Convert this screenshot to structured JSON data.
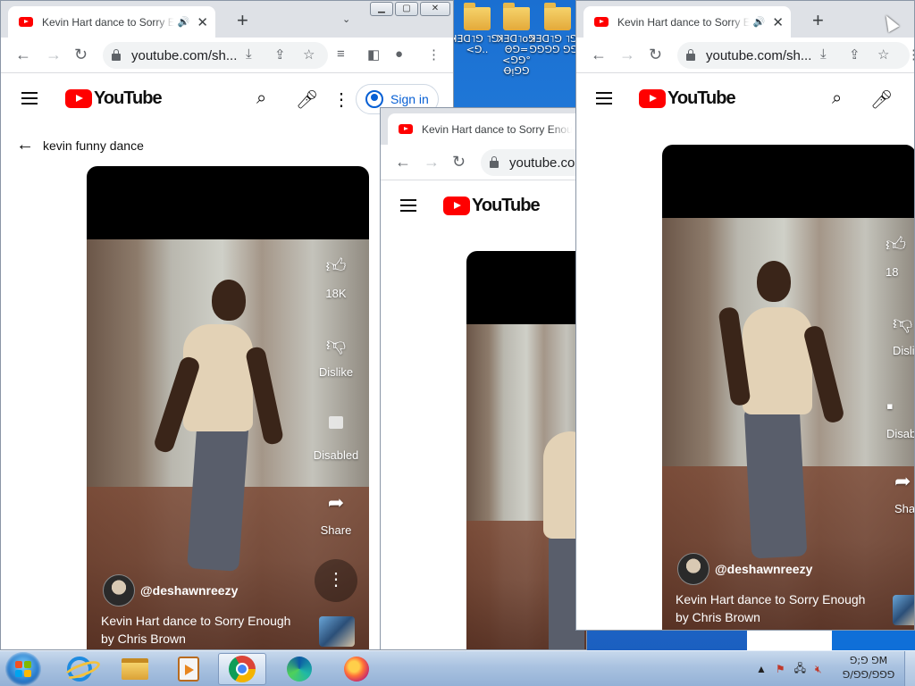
{
  "desktop": {
    "icons": [
      {
        "label": "ꓘƎᗡ˥ꓨ ˥ꓨ°\n<ꓨ..",
        "icon": "folder-icon"
      },
      {
        "label": "ꓘƎᗡ˥oꓨ Θꓨ=\n<ꓨꓨ° Ꝋᴉꓨꓨ",
        "icon": "folder-icon"
      },
      {
        "label": "ꓘƎᗡ˥ꓨ ˥ꓨ=\nꓨꓨꓨꓨ ꓨꓨꓨ",
        "icon": "folder-icon"
      }
    ]
  },
  "windows": [
    {
      "id": "left",
      "tab_title": "Kevin Hart dance to Sorry Enough",
      "url": "youtube.com/sh...",
      "youtube_label": "YouTube",
      "sign_in": "Sign in",
      "back_label": "kevin funny dance",
      "likes": "18K",
      "dislike": "Dislike",
      "comments": "Disabled",
      "share": "Share",
      "channel": "@deshawnreezy",
      "video_title_line1": "Kevin Hart dance to Sorry Enough",
      "video_title_line2": "by Chris Brown"
    },
    {
      "id": "middle",
      "tab_title": "Kevin Hart dance to Sorry Enough",
      "url": "youtube.com",
      "youtube_label": "YouTube"
    },
    {
      "id": "right",
      "tab_title": "Kevin Hart dance to Sorry Enough",
      "url": "youtube.com/sh...",
      "youtube_label": "YouTube",
      "likes": "18",
      "dislike": "Disli",
      "comments": "Disab",
      "share": "Sha",
      "channel": "@deshawnreezy",
      "video_title_line1": "Kevin Hart dance to Sorry Enough",
      "video_title_line2": "by Chris Brown"
    }
  ],
  "taskbar": {
    "apps": [
      "internet-explorer-icon",
      "file-explorer-icon",
      "media-player-icon",
      "chrome-icon",
      "edge-icon",
      "firefox-icon"
    ],
    "active_app": "chrome-icon",
    "clock_line1": "ꓨ;ꓨ ꓨM",
    "clock_line2": "ꓨ/ꓨꓨ/ꓨꓨꓨ"
  }
}
